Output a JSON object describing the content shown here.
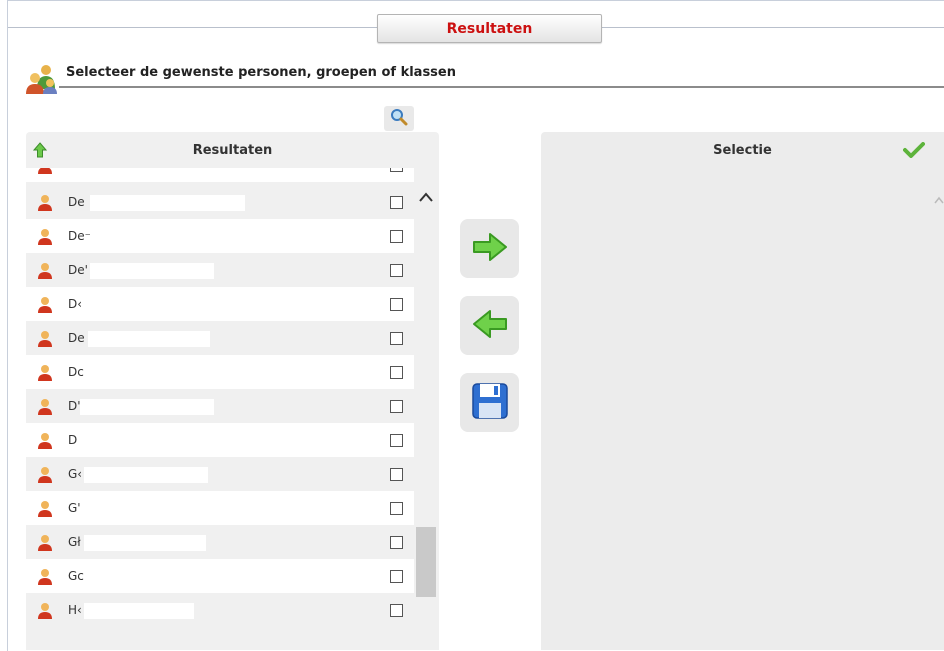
{
  "header": {
    "tab_label": "Resultaten"
  },
  "instruction": {
    "text": "Selecteer de gewenste personen, groepen of klassen",
    "icon": "group-people-icon"
  },
  "search": {
    "icon": "search-icon"
  },
  "results_panel": {
    "title": "Resultaten",
    "icons": {
      "sort": "green-up-arrow-icon",
      "person": "person-icon",
      "scroll_up": "chevron-up-icon"
    },
    "rows": [
      {
        "name": ""
      },
      {
        "name": "De"
      },
      {
        "name": "De⁻"
      },
      {
        "name": "De'"
      },
      {
        "name": "D‹"
      },
      {
        "name": "De"
      },
      {
        "name": "Dc"
      },
      {
        "name": "D'"
      },
      {
        "name": "D"
      },
      {
        "name": "G‹"
      },
      {
        "name": "G'"
      },
      {
        "name": "Gł"
      },
      {
        "name": "Gc"
      },
      {
        "name": "H‹"
      }
    ]
  },
  "actions": {
    "add": "green-right-arrow-icon",
    "remove": "green-left-arrow-icon",
    "save": "floppy-disk-icon"
  },
  "selection_panel": {
    "title": "Selectie",
    "icon": "checkmark-icon"
  },
  "colors": {
    "tab_text": "#cc1111",
    "arrow_green": "#5fc23a",
    "save_blue": "#2e6fd1"
  }
}
